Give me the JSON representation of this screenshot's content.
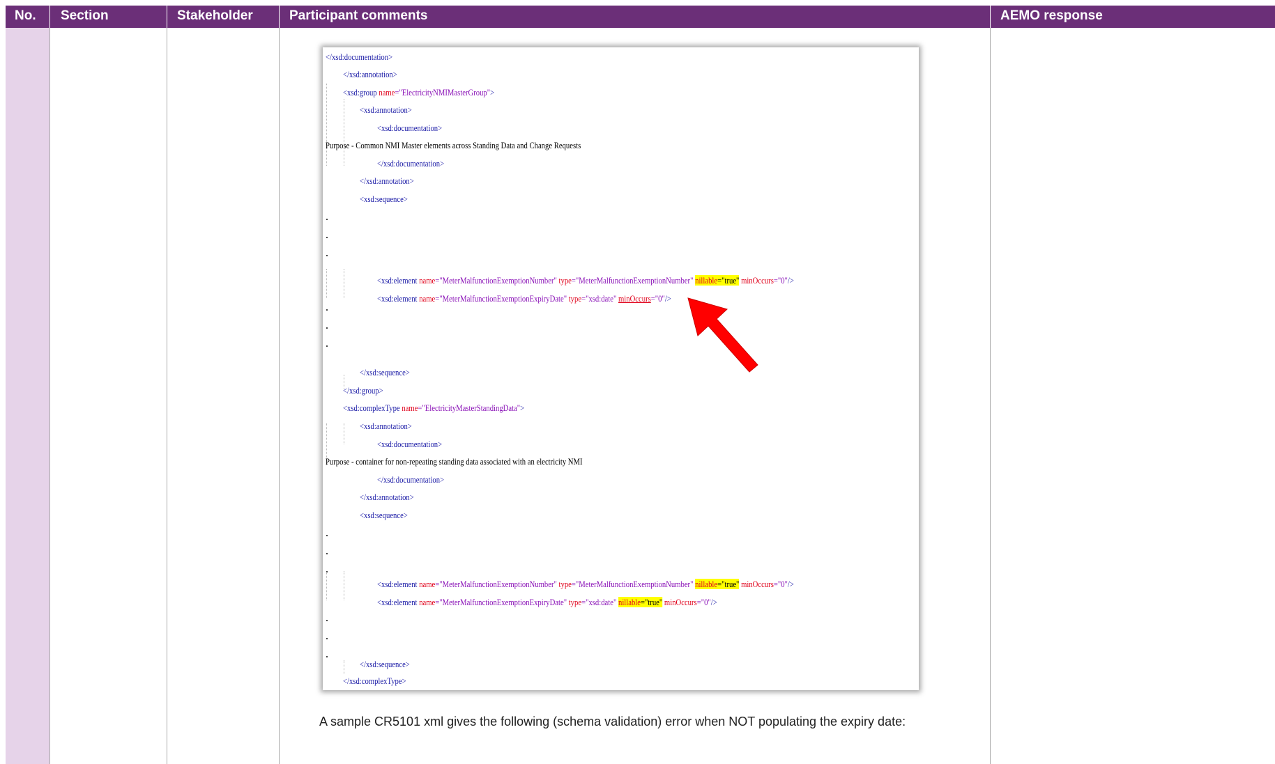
{
  "table": {
    "headers": {
      "no": "No.",
      "section": "Section",
      "stakeholder": "Stakeholder",
      "participant_comments": "Participant comments",
      "aemo_response": "AEMO response"
    },
    "colors": {
      "header_bg": "#6b2f78",
      "no_column_bg": "#e6d3e9"
    }
  },
  "code_screenshot": {
    "lines": {
      "l1": "</xsd:documentation>",
      "l2": "</xsd:annotation>",
      "l3_tag": "<xsd:group ",
      "l3_attr": "name",
      "l3_val": "=\"ElectricityNMIMasterGroup\"",
      "l3_end": ">",
      "l4": "<xsd:annotation>",
      "l5": "<xsd:documentation>",
      "l6": "Purpose - Common NMI Master elements across Standing Data and Change Requests",
      "l7": "</xsd:documentation>",
      "l8": "</xsd:annotation>",
      "l9": "<xsd:sequence>",
      "e1_tag": "<xsd:element ",
      "e1_a1": "name",
      "e1_v1": "=\"MeterMalfunctionExemptionNumber\" ",
      "e1_a2": "type",
      "e1_v2": "=\"MeterMalfunctionExemptionNumber\" ",
      "e1_a3": "nillable",
      "e1_v3": "=\"true\"",
      "e1_a4": " minOccurs",
      "e1_v4": "=\"0\"",
      "e1_end": "/>",
      "e2_tag": "<xsd:element ",
      "e2_a1": "name",
      "e2_v1": "=\"MeterMalfunctionExemptionExpiryDate\" ",
      "e2_a2": "type",
      "e2_v2": "=\"xsd:date\" ",
      "e2_a3": "minOccurs",
      "e2_v3": "=\"0\"",
      "e2_end": "/>",
      "l12": "</xsd:sequence>",
      "l13": "</xsd:group>",
      "l14_tag": "<xsd:complexType ",
      "l14_attr": "name",
      "l14_val": "=\"ElectricityMasterStandingData\"",
      "l14_end": ">",
      "l15": "<xsd:annotation>",
      "l16": "<xsd:documentation>",
      "l17": "Purpose - container for non-repeating standing data associated with an electricity NMI",
      "l18": "</xsd:documentation>",
      "l19": "</xsd:annotation>",
      "l20": "<xsd:sequence>",
      "e3_tag": "<xsd:element ",
      "e3_a1": "name",
      "e3_v1": "=\"MeterMalfunctionExemptionNumber\" ",
      "e3_a2": "type",
      "e3_v2": "=\"MeterMalfunctionExemptionNumber\" ",
      "e3_a3": "nillable",
      "e3_v3": "=\"true\"",
      "e3_a4": " minOccurs",
      "e3_v4": "=\"0\"",
      "e3_end": "/>",
      "e4_tag": "<xsd:element ",
      "e4_a1": "name",
      "e4_v1": "=\"MeterMalfunctionExemptionExpiryDate\" ",
      "e4_a2": "type",
      "e4_v2": "=\"xsd:date\" ",
      "e4_a3": "nillable",
      "e4_v3": "=\"true\"",
      "e4_a4": " minOccurs",
      "e4_v4": "=\"0\"",
      "e4_end": "/>",
      "l23": "</xsd:sequence>",
      "l24": "</xsd:complexType>"
    },
    "colors": {
      "tag": "#1a1aa6",
      "attribute": "#e0001a",
      "value": "#8a12b7",
      "highlight": "#ffff00",
      "arrow": "#ff0000"
    }
  },
  "caption": "A sample CR5101 xml gives the following (schema validation) error when NOT populating the expiry date:"
}
